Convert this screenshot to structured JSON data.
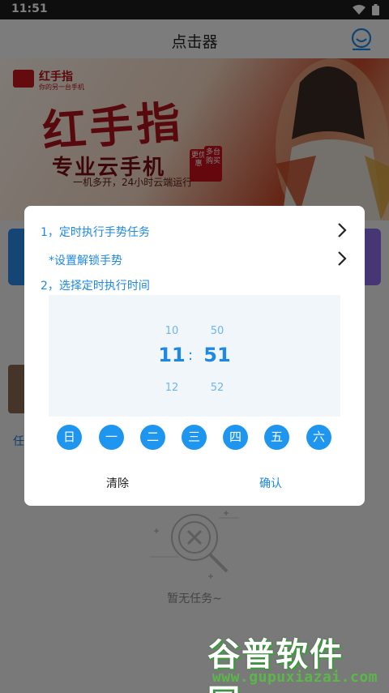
{
  "status_bar": {
    "time": "11:51"
  },
  "app_bar": {
    "title": "点击器"
  },
  "banner": {
    "logo_text": "红手指",
    "logo_sub": "你的另一台手机",
    "headline": "红手指",
    "subheadline": "专业云手机",
    "tagline": "一机多开，24小时云端运行",
    "badge_left": "更优惠",
    "badge_right": "多台购买"
  },
  "background": {
    "task_label": "任",
    "empty_text": "暂无任务~"
  },
  "dialog": {
    "step1_label": "1，定时执行手势任务",
    "unlock_label": "*设置解锁手势",
    "step2_label": "2，选择定时执行时间",
    "time_picker": {
      "hour_prev": "10",
      "hour": "11",
      "hour_next": "12",
      "minute_prev": "50",
      "minute": "51",
      "minute_next": "52",
      "separator": ":"
    },
    "days": [
      "日",
      "一",
      "二",
      "三",
      "四",
      "五",
      "六"
    ],
    "clear_label": "清除",
    "confirm_label": "确认"
  },
  "watermark": {
    "title": "谷普软件园",
    "url": "www.gupuxiazai.com"
  },
  "colors": {
    "accent": "#1e88e5",
    "day_button": "#1e96f0",
    "picker_bg": "#f1f6fa",
    "overlay": "rgba(0,0,0,0.5)"
  }
}
